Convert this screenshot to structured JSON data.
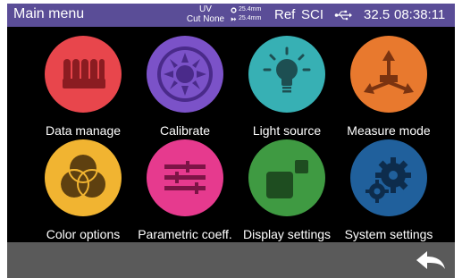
{
  "status": {
    "title": "Main menu",
    "uv_line1": "UV",
    "uv_line2": "Cut None",
    "size1": "25.4mm",
    "size2": "25.4mm",
    "ref": "Ref",
    "sci": "SCI",
    "usb_icon": "usb-icon",
    "temperature": "32.5",
    "time": "08:38:11"
  },
  "menu": {
    "data_manage": "Data manage",
    "calibrate": "Calibrate",
    "light_source": "Light source",
    "measure_mode": "Measure mode",
    "color_options": "Color options",
    "parametric_coeff": "Parametric coeff.",
    "display_settings": "Display settings",
    "system_settings": "System settings"
  },
  "colors": {
    "status_bar": "#5a4d97",
    "data_manage": "#e8464c",
    "calibrate": "#7b52c8",
    "light_source": "#37b0b4",
    "measure_mode": "#e8792e",
    "color_options": "#f1b431",
    "parametric_coeff": "#e63a8e",
    "display_settings": "#3f9a42",
    "system_settings": "#20609c"
  },
  "bottom": {
    "back_icon": "back-arrow-icon"
  }
}
